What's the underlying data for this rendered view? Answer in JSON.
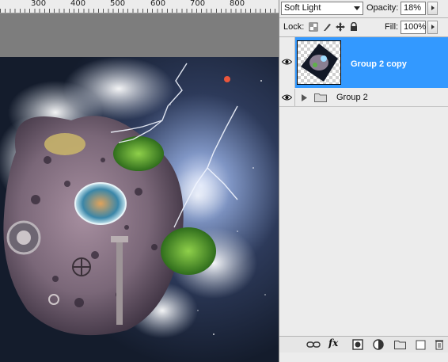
{
  "ruler": {
    "numbers": [
      "300",
      "400",
      "500",
      "600",
      "700",
      "800"
    ]
  },
  "layers_panel": {
    "blend_mode": "Soft Light",
    "opacity_label": "Opacity:",
    "opacity_value": "18%",
    "lock_label": "Lock:",
    "fill_label": "Fill:",
    "fill_value": "100%",
    "layers": [
      {
        "name": "Group 2 copy",
        "type": "layer",
        "selected": true,
        "visible": true
      },
      {
        "name": "Group 2",
        "type": "group",
        "selected": false,
        "visible": true
      }
    ],
    "bottom_icons": [
      "link-icon",
      "fx-icon",
      "mask-icon",
      "adjustment-icon",
      "folder-icon",
      "new-layer-icon",
      "trash-icon"
    ],
    "fx_label": "fx"
  },
  "colors": {
    "selection": "#3399ff",
    "panel_bg": "#ececec",
    "canvas_bg": "#1a2438"
  }
}
